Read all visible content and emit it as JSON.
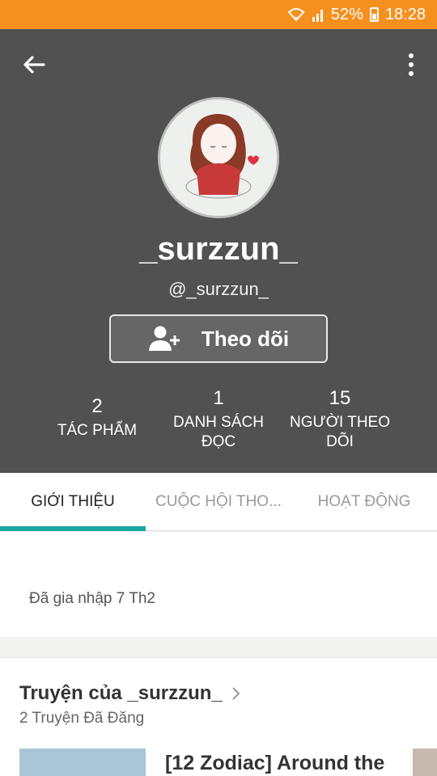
{
  "status_bar": {
    "battery": "52%",
    "time": "18:28"
  },
  "profile": {
    "display_name": "_surzzun_",
    "handle": "@_surzzun_",
    "follow_label": "Theo dõi"
  },
  "stats": [
    {
      "value": "2",
      "label_line1": "TÁC PHẨM",
      "label_line2": ""
    },
    {
      "value": "1",
      "label_line1": "DANH SÁCH",
      "label_line2": "ĐỌC"
    },
    {
      "value": "15",
      "label_line1": "NGƯỜI THEO",
      "label_line2": "DÕI"
    }
  ],
  "tabs": [
    {
      "label": "GIỚI THIỆU",
      "active": true
    },
    {
      "label": "CUỘC HỘI THO...",
      "active": false
    },
    {
      "label": "HOẠT ĐỘNG",
      "active": false
    }
  ],
  "about": {
    "joined": "Đã gia nhập 7 Th2"
  },
  "stories": {
    "title": "Truyện của _surzzun_",
    "count": "2 Truyện Đã Đăng",
    "items": [
      {
        "title": "[12 Zodiac] Around the"
      }
    ]
  },
  "colors": {
    "status_bar": "#f5901e",
    "header": "#515151",
    "tab_indicator": "#1aa7a3"
  },
  "icons": [
    "wifi-icon",
    "signal-icon",
    "battery-icon",
    "back-arrow-icon",
    "more-vert-icon",
    "add-person-icon",
    "chevron-right-icon"
  ]
}
